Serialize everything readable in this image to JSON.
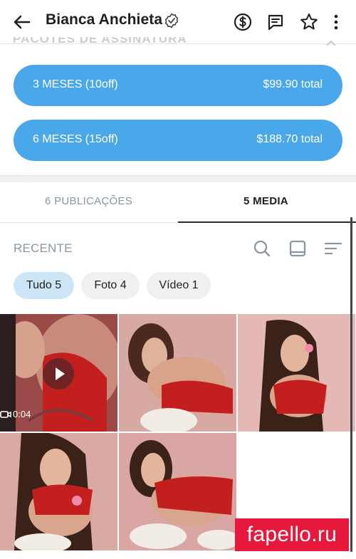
{
  "header": {
    "title": "Bianca Anchieta",
    "back_icon": "arrow-left-icon",
    "verified_icon": "verified-badge-icon",
    "actions": [
      "dollar-circle-icon",
      "message-icon",
      "star-icon",
      "more-vertical-icon"
    ]
  },
  "subscription": {
    "section_label": "PACOTES DE ASSINATURA",
    "plans": [
      {
        "label": "3 MESES (10off)",
        "price": "$99.90 total"
      },
      {
        "label": "6 MESES (15off)",
        "price": "$188.70 total"
      }
    ]
  },
  "tabs": [
    {
      "label": "6 PUBLICAÇÕES",
      "active": false
    },
    {
      "label": "5 MEDIA",
      "active": true
    }
  ],
  "filters": {
    "label": "RECENTE",
    "icons": [
      "search-icon",
      "layout-icon",
      "sort-icon"
    ],
    "chips": [
      {
        "label": "Tudo 5",
        "active": true
      },
      {
        "label": "Foto 4",
        "active": false
      },
      {
        "label": "Vídeo 1",
        "active": false
      }
    ]
  },
  "media": {
    "video_duration": "0:04"
  },
  "watermark": "fapello.ru",
  "colors": {
    "accent": "#4aa8ea",
    "chip_active": "#cde6f7",
    "chip": "#eef0f2",
    "watermark": "#e8183c"
  }
}
